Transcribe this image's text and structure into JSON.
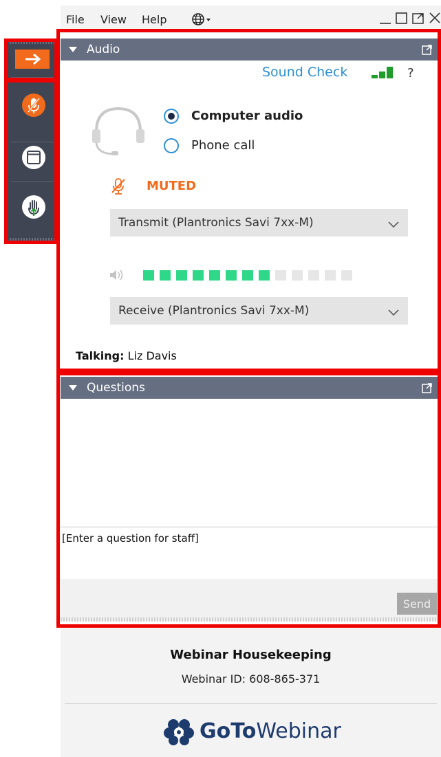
{
  "menu": {
    "items": [
      "File",
      "View",
      "Help"
    ]
  },
  "colors": {
    "accent_orange": "#f26a1b",
    "link_blue": "#2b8fd6",
    "header_gray": "#666f82",
    "rail_dark": "#3f4553",
    "meter_on": "#2fd889",
    "meter_off": "#e6e6e6",
    "signal_green": "#1f9d2b",
    "annotation_red": "#ee0000"
  },
  "rail": {
    "icons": [
      "arrow-right-icon",
      "mic-muted-icon",
      "window-icon",
      "raise-hand-icon"
    ]
  },
  "audio": {
    "title": "Audio",
    "sound_check": "Sound Check",
    "help": "?",
    "options": [
      {
        "label": "Computer audio",
        "selected": true
      },
      {
        "label": "Phone call",
        "selected": false
      }
    ],
    "status": "MUTED",
    "transmit_device": "Transmit (Plantronics Savi 7xx-M)",
    "receive_device": "Receive (Plantronics Savi 7xx-M)",
    "volume_level": {
      "filled": 8,
      "total": 13
    },
    "talking_label": "Talking:",
    "talking_name": "Liz Davis"
  },
  "questions": {
    "title": "Questions",
    "input_placeholder": "[Enter a question for staff]",
    "send_label": "Send"
  },
  "footer": {
    "title": "Webinar Housekeeping",
    "webinar_id": "Webinar ID: 608-865-371",
    "brand_goto": "GoTo",
    "brand_webinar": "Webinar"
  }
}
